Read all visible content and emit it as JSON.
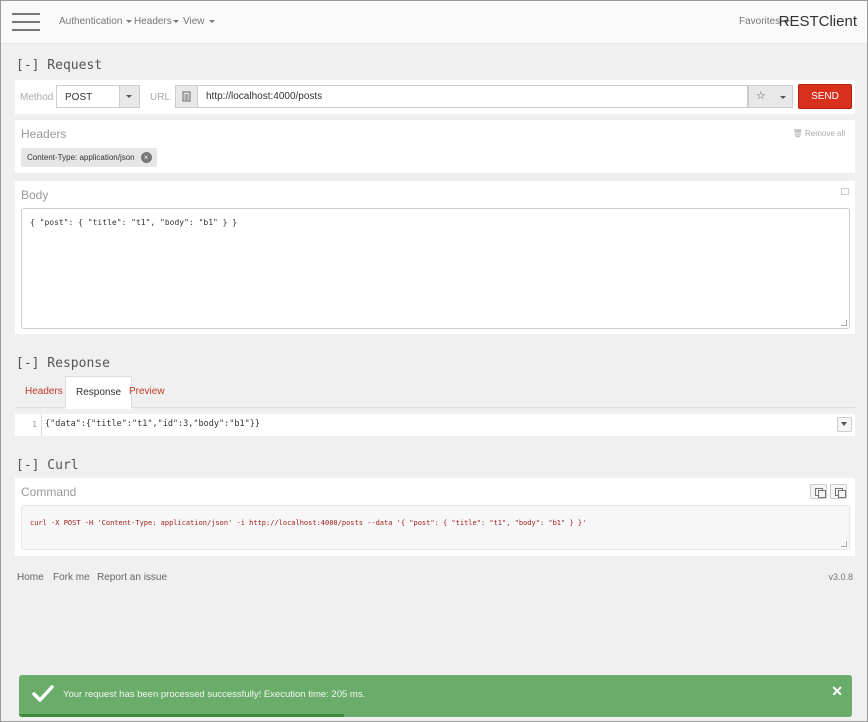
{
  "navbar": {
    "menu": [
      {
        "label": "Authentication"
      },
      {
        "label": "Headers"
      },
      {
        "label": "View"
      }
    ],
    "favorites_label": "Favorites",
    "brand": "RESTClient"
  },
  "request": {
    "section_title": "[-] Request",
    "method_label": "Method",
    "method_value": "POST",
    "url_label": "URL",
    "url_value": "http://localhost:4000/posts",
    "send_label": "SEND"
  },
  "headers": {
    "title": "Headers",
    "remove_all_label": "Remove all",
    "items": [
      {
        "label": "Content-Type: application/json"
      }
    ]
  },
  "body": {
    "title": "Body",
    "content": "{ \"post\": { \"title\": \"t1\", \"body\": \"b1\" } }"
  },
  "response": {
    "section_title": "[-] Response",
    "tabs": [
      {
        "label": "Headers",
        "active": false
      },
      {
        "label": "Response",
        "active": true
      },
      {
        "label": "Preview",
        "active": false
      }
    ],
    "line_number": "1",
    "content": "{\"data\":{\"title\":\"t1\",\"id\":3,\"body\":\"b1\"}}"
  },
  "curl": {
    "section_title": "[-] Curl",
    "command_title": "Command",
    "command": "curl -X POST -H 'Content-Type: application/json' -i http://localhost:4000/posts --data '{ \"post\": { \"title\": \"t1\", \"body\": \"b1\" } }'"
  },
  "footer": {
    "links": [
      "Home",
      "Fork me",
      "Report an issue"
    ],
    "version": "v3.0.8"
  },
  "toast": {
    "message": "Your request has been processed successfully! Execution time: 205 ms.",
    "progress_fraction": 0.39,
    "color": "#6aac6a"
  },
  "colors": {
    "send_button": "#d9301e",
    "inactive_tab": "#c0392b",
    "toast_bg": "#6aac6a"
  }
}
